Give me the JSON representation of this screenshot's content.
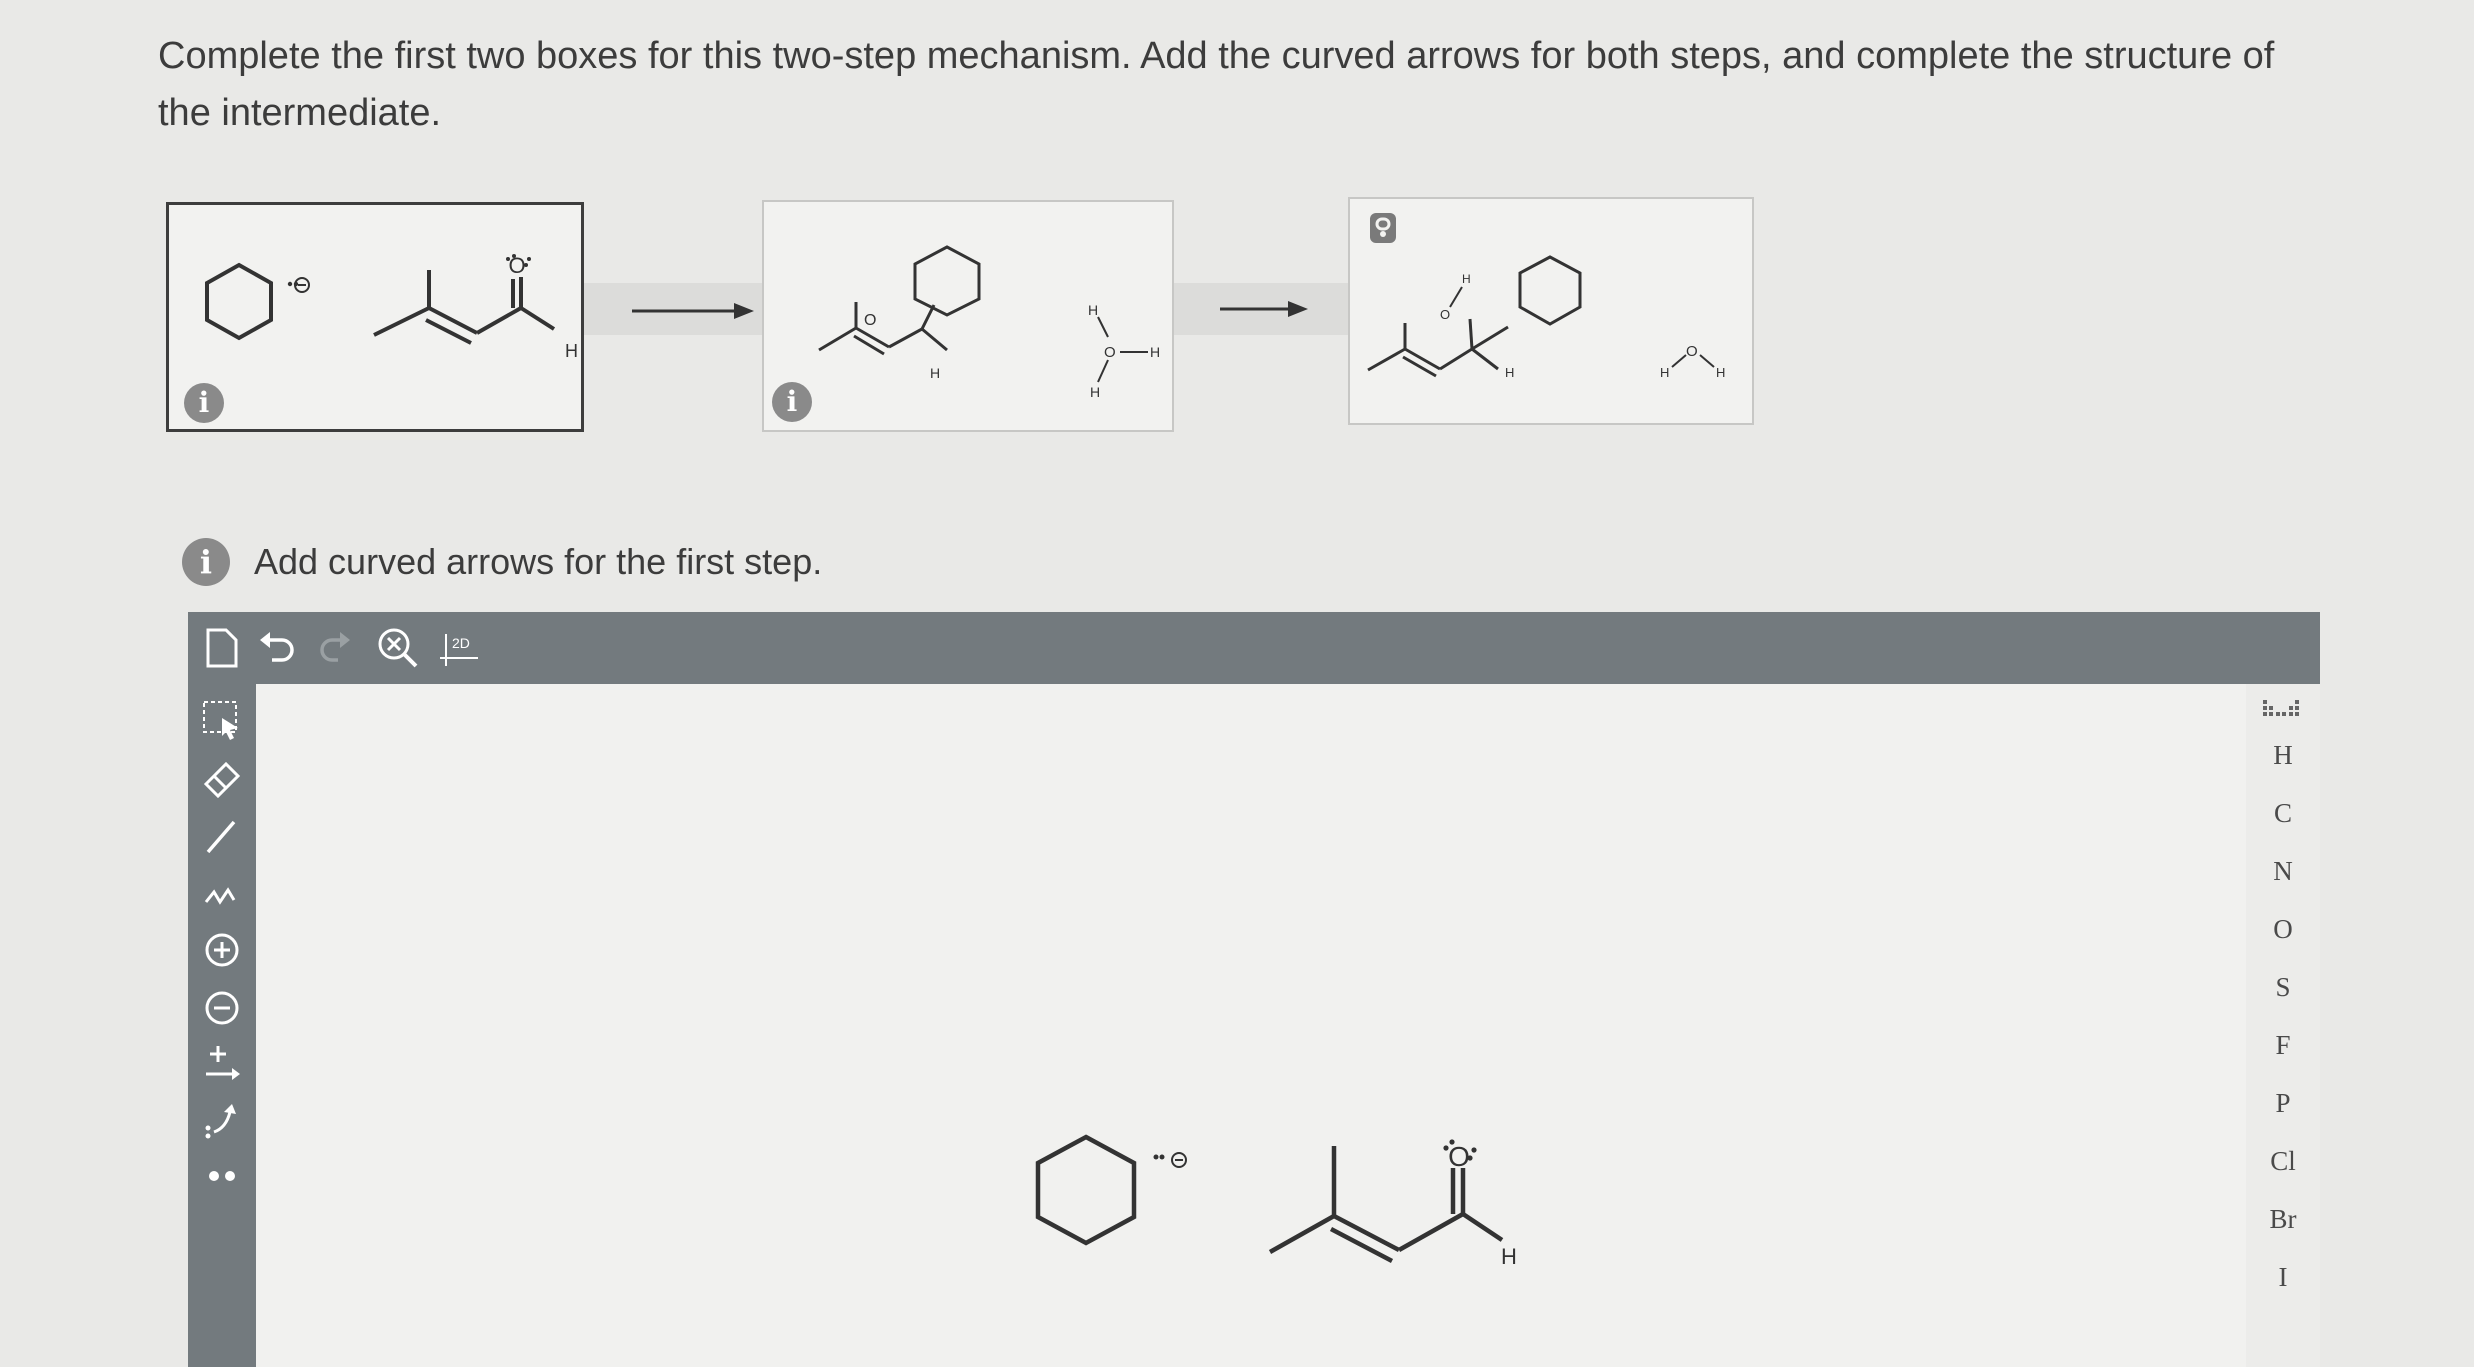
{
  "prompt": {
    "text": "Complete the first two boxes for this two-step mechanism. Add the curved arrows for both steps, and complete the structure of the intermediate."
  },
  "mechanism": {
    "box1": {
      "info_icon": "info-icon",
      "label_h": "H",
      "label_o": "O"
    },
    "box2": {
      "info_icon": "info-icon",
      "label_o": "O",
      "label_h": "H",
      "water_h_top": "H",
      "water_h_bottom": "H",
      "water_o": "O",
      "water_h_right": "H"
    },
    "box3": {
      "lock_icon": "lock-icon",
      "label_h_top": "H",
      "label_o": "O",
      "label_h": "H",
      "water_h_left": "H",
      "water_o": "O",
      "water_h_right": "H"
    }
  },
  "step_instruction": {
    "icon": "info-icon",
    "text": "Add curved arrows for the first step."
  },
  "editor": {
    "top_tools": [
      "new-document-icon",
      "undo-icon",
      "redo-icon",
      "zoom-clear-icon",
      "2d-clean-icon"
    ],
    "clean_label": "2D",
    "left_tools": [
      "select-icon",
      "eraser-icon",
      "bond-icon",
      "chain-icon",
      "plus-charge-icon",
      "minus-charge-icon",
      "arrow-icon",
      "curved-arrow-icon",
      "lone-pair-icon"
    ],
    "elements": [
      "H",
      "C",
      "N",
      "O",
      "S",
      "F",
      "P",
      "Cl",
      "Br",
      "I"
    ],
    "canvas": {
      "label_h": "H",
      "label_o": "O"
    }
  },
  "glyphs": {
    "info": "i",
    "minus": "⊖"
  }
}
